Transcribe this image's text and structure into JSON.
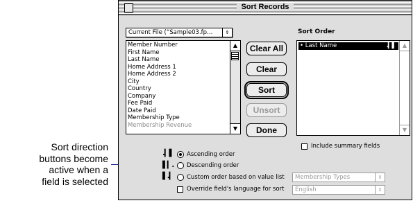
{
  "window": {
    "title": "Sort Records"
  },
  "file_popup": {
    "value": "Current File (“Sample03.fp…"
  },
  "field_list": {
    "items": [
      "Member Number",
      "First Name",
      "Last Name",
      "Home Address 1",
      "Home Address 2",
      "City",
      "Country",
      "Company",
      "Fee Paid",
      "Date Paid",
      "Membership Type",
      "Membership Revenue"
    ]
  },
  "buttons": {
    "clear_all": "Clear All",
    "clear": "Clear",
    "sort": "Sort",
    "unsort": "Unsort",
    "done": "Done"
  },
  "sort_order": {
    "heading": "Sort Order",
    "items": [
      {
        "bullet": "•",
        "label": "Last Name",
        "direction_glyph": ".▎▌"
      }
    ]
  },
  "options": {
    "include_summary": "Include summary fields",
    "ascending": "Ascending order",
    "descending": "Descending order",
    "custom": "Custom order based on value list",
    "custom_popup": "Membership Types",
    "override_language": "Override field's language for sort",
    "language_popup": "English"
  },
  "direction_icons": {
    "ascending": ".▎▌",
    "descending": "▌▎.",
    "custom": "▌.▎"
  },
  "callout": {
    "lines": [
      "Sort direction",
      "buttons become",
      "active when a",
      "field is selected"
    ]
  },
  "colors": {
    "callout_line": "#1b2a9a",
    "dialog_bg": "#dedede"
  }
}
